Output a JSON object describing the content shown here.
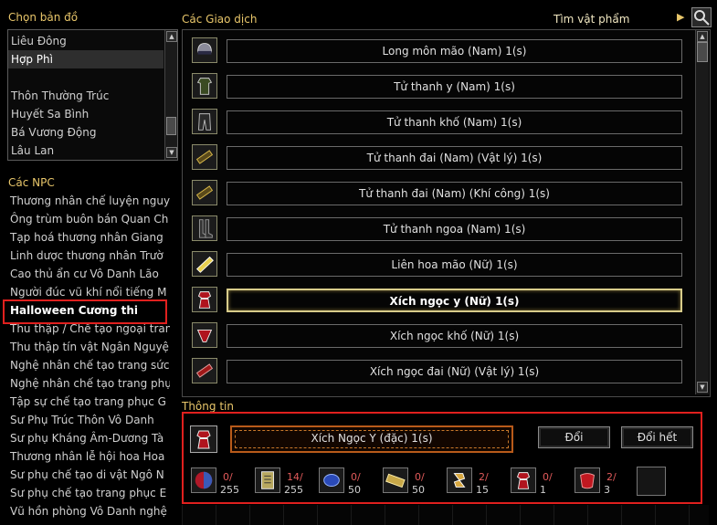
{
  "map_section": {
    "title": "Chọn bản đồ",
    "items": [
      "Liêu Đông",
      "Hợp Phì",
      "",
      "Thôn Thường Trúc",
      "Huyết Sa Bình",
      "Bá Vương Động",
      "Lâu Lan"
    ],
    "selected_index": 1
  },
  "npc_section": {
    "title": "Các NPC",
    "items": [
      "Thương nhân chế luyện nguy",
      "Ông trùm buôn bán Quan Ch",
      "Tạp hoá thương nhân Giang",
      "Linh dược thương nhân Trườ",
      "Cao thủ ẩn cư Vô Danh Lão",
      "Người đúc vũ khí nổi tiếng M",
      "Halloween Cương thi",
      "Thu thập / Chế tạo ngoại tran",
      "Thu thập tín vật Ngân Nguyệ",
      "Nghệ nhân chế tạo trang sức",
      "Nghệ nhân chế tạo trang phụ",
      "Tập sự chế tạo trang phục G",
      "Sư Phụ Trúc Thôn Vô Danh",
      "Sư phụ Kháng Âm-Dương Tà",
      "Thương nhân lễ hội hoa Hoa",
      "Sư phụ chế tạo di vật Ngô N",
      "Sư phụ chế tạo trang phục E",
      "Vũ hồn phòng Vô Danh nghệ"
    ],
    "selected_index": 6
  },
  "trades_section": {
    "title": "Các Giao dịch",
    "search_label": "Tìm vật phẩm",
    "items": [
      {
        "label": "Long môn mão (Nam) 1(s)",
        "icon": "helmet-icon"
      },
      {
        "label": "Tử thanh y (Nam) 1(s)",
        "icon": "robe-icon"
      },
      {
        "label": "Tử thanh khố (Nam) 1(s)",
        "icon": "pants-icon"
      },
      {
        "label": "Tử thanh đai (Nam) (Vật lý) 1(s)",
        "icon": "belt-icon"
      },
      {
        "label": "Tử thanh đai (Nam) (Khí công) 1(s)",
        "icon": "belt-icon"
      },
      {
        "label": "Tử thanh ngoa (Nam) 1(s)",
        "icon": "boots-icon"
      },
      {
        "label": "Liên hoa mão (Nữ) 1(s)",
        "icon": "hat-icon"
      },
      {
        "label": "Xích ngọc y (Nữ) 1(s)",
        "icon": "dress-icon"
      },
      {
        "label": "Xích ngọc khố (Nữ) 1(s)",
        "icon": "skirt-icon"
      },
      {
        "label": "Xích ngọc đai (Nữ) (Vật lý) 1(s)",
        "icon": "sash-icon"
      }
    ],
    "selected_index": 7
  },
  "info_section": {
    "title": "Thông tin",
    "product_name": "Xích Ngọc Y (đặc) 1(s)",
    "exchange_label": "Đổi",
    "exchange_all_label": "Đổi hết",
    "materials": [
      {
        "icon": "red-orb-icon",
        "have": "0/",
        "need": "255"
      },
      {
        "icon": "scroll-icon",
        "have": "14/",
        "need": "255"
      },
      {
        "icon": "blue-gem-icon",
        "have": "0/",
        "need": "50"
      },
      {
        "icon": "gold-bar-icon",
        "have": "0/",
        "need": "50"
      },
      {
        "icon": "rune-icon",
        "have": "2/",
        "need": "15"
      },
      {
        "icon": "red-robe-icon",
        "have": "0/",
        "need": "1"
      },
      {
        "icon": "red-cloth-icon",
        "have": "2/",
        "need": "3"
      }
    ]
  },
  "colors": {
    "accent": "#e8c66a",
    "highlight": "#e0201e",
    "insufficient": "#e05a5a"
  }
}
